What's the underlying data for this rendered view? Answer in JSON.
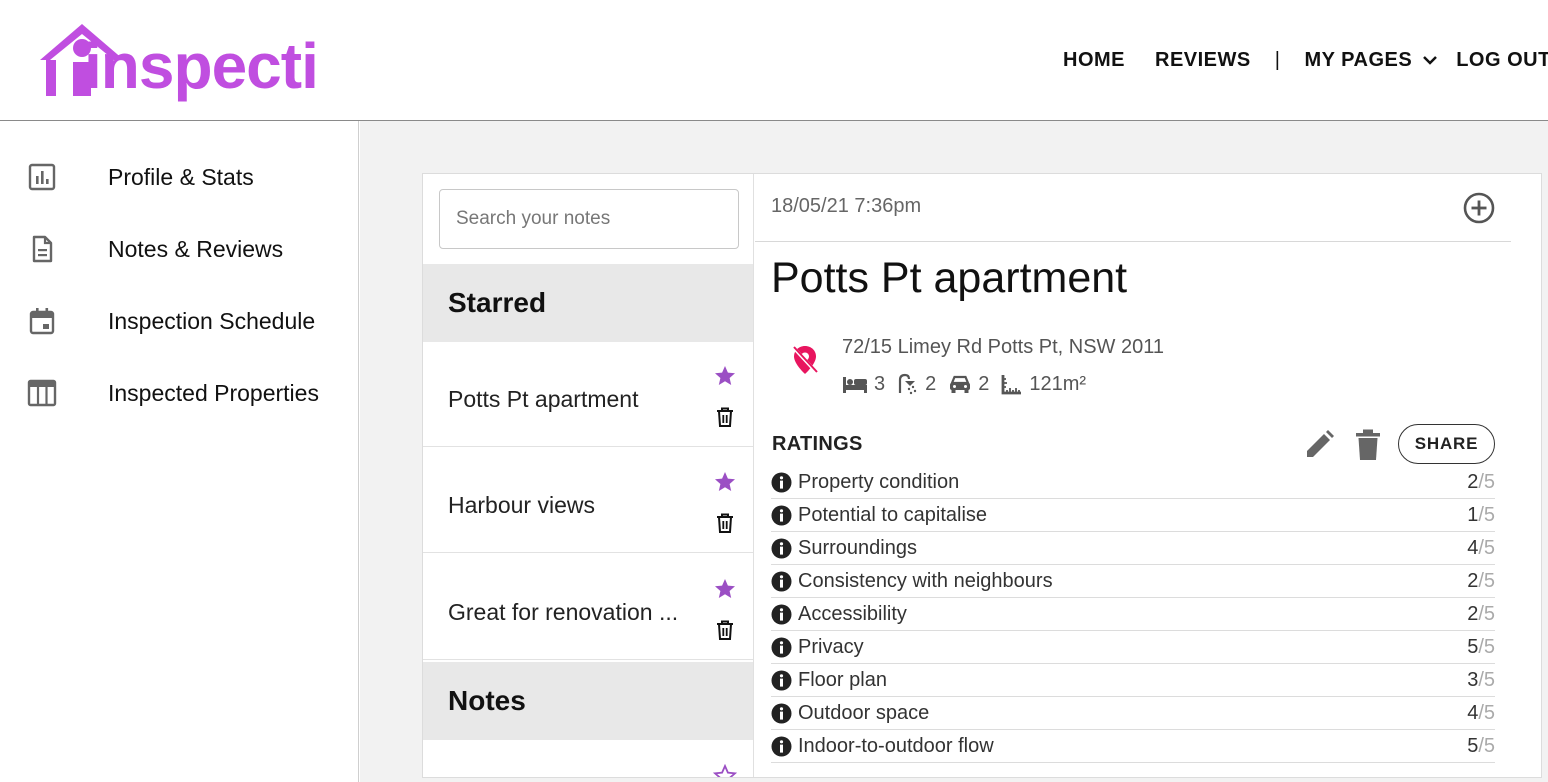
{
  "brand": {
    "name": "inspecti",
    "color": "#c04ee0"
  },
  "nav": {
    "home": "HOME",
    "reviews": "REVIEWS",
    "separator": "|",
    "my_pages": "MY PAGES",
    "logout": "LOG OUT"
  },
  "sidebar": {
    "items": [
      {
        "label": "Profile & Stats",
        "icon": "bar-chart-icon"
      },
      {
        "label": "Notes & Reviews",
        "icon": "document-icon"
      },
      {
        "label": "Inspection Schedule",
        "icon": "calendar-icon"
      },
      {
        "label": "Inspected Properties",
        "icon": "table-icon"
      }
    ]
  },
  "notes_list": {
    "search_placeholder": "Search your notes",
    "starred_heading": "Starred",
    "notes_heading": "Notes",
    "starred": [
      {
        "title": "Potts Pt apartment"
      },
      {
        "title": "Harbour views"
      },
      {
        "title": "Great for renovation ..."
      }
    ],
    "star_color": "#9b4fc4"
  },
  "detail": {
    "date": "18/05/21 7:36pm",
    "title": "Potts Pt apartment",
    "address": "72/15 Limey Rd Potts Pt, NSW 2011",
    "beds": "3",
    "baths": "2",
    "cars": "2",
    "area": "121m²",
    "pin_color": "#e8155f",
    "ratings_heading": "RATINGS",
    "share_label": "SHARE",
    "ratings": [
      {
        "label": "Property condition",
        "score": "2",
        "max": "/5"
      },
      {
        "label": "Potential to capitalise",
        "score": "1",
        "max": "/5"
      },
      {
        "label": "Surroundings",
        "score": "4",
        "max": "/5"
      },
      {
        "label": "Consistency with neighbours",
        "score": "2",
        "max": "/5"
      },
      {
        "label": "Accessibility",
        "score": "2",
        "max": "/5"
      },
      {
        "label": "Privacy",
        "score": "5",
        "max": "/5"
      },
      {
        "label": "Floor plan",
        "score": "3",
        "max": "/5"
      },
      {
        "label": "Outdoor space",
        "score": "4",
        "max": "/5"
      },
      {
        "label": "Indoor-to-outdoor flow",
        "score": "5",
        "max": "/5"
      }
    ]
  }
}
